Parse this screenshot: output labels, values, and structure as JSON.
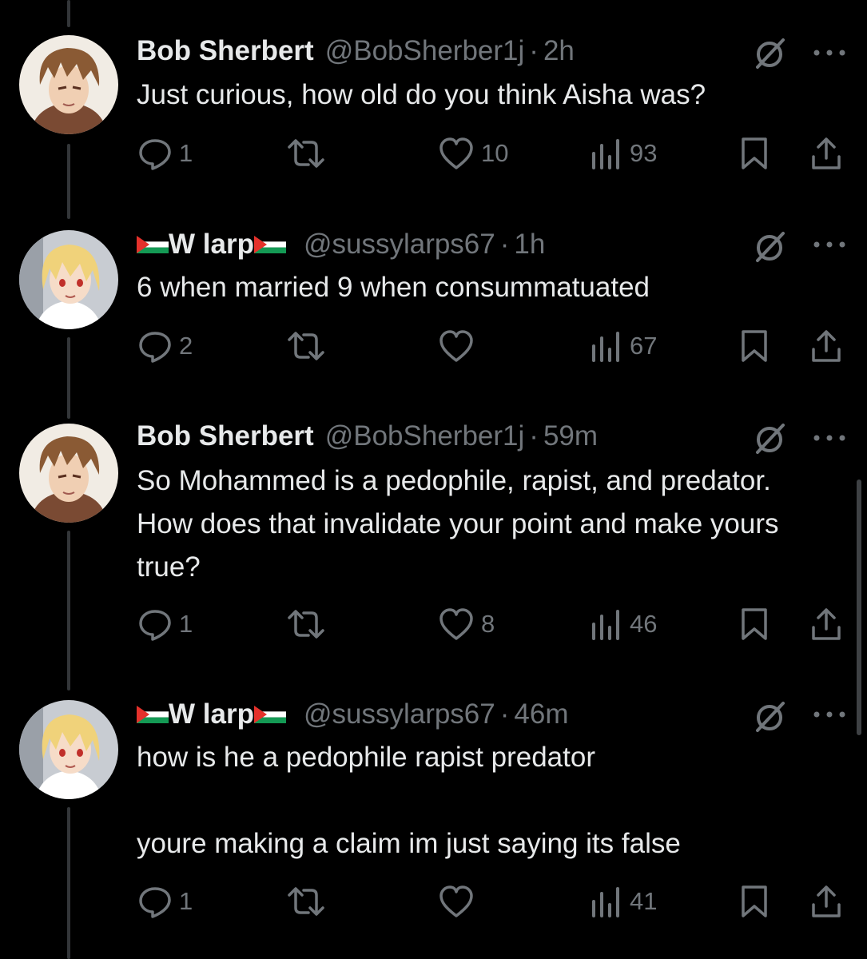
{
  "colors": {
    "background": "#000000",
    "text": "#e7e9ea",
    "muted": "#71767b",
    "thread_line": "#333639"
  },
  "tweets": [
    {
      "name": "Bob Sherbert",
      "name_flags": false,
      "handle": "@BobSherber1j",
      "separator": "·",
      "time": "2h",
      "avatar": "brown-haired-anime-avatar",
      "text": "Just curious, how old do you think Aisha was?",
      "replies": "1",
      "reposts": "",
      "likes": "10",
      "views": "93"
    },
    {
      "name": "W larp",
      "name_flags": true,
      "handle": "@sussylarps67",
      "separator": "·",
      "time": "1h",
      "avatar": "blonde-anime-avatar",
      "text": "6 when married 9 when consummatuated",
      "replies": "2",
      "reposts": "",
      "likes": "",
      "views": "67"
    },
    {
      "name": "Bob Sherbert",
      "name_flags": false,
      "handle": "@BobSherber1j",
      "separator": "·",
      "time": "59m",
      "avatar": "brown-haired-anime-avatar",
      "text": "So Mohammed is a pedophile, rapist, and predator. How does that invalidate your point and make yours true?",
      "replies": "1",
      "reposts": "",
      "likes": "8",
      "views": "46"
    },
    {
      "name": "W larp",
      "name_flags": true,
      "handle": "@sussylarps67",
      "separator": "·",
      "time": "46m",
      "avatar": "blonde-anime-avatar",
      "text": "how is he a pedophile rapist predator\n\nyoure making a claim im just saying its false",
      "replies": "1",
      "reposts": "",
      "likes": "",
      "views": "41"
    }
  ]
}
